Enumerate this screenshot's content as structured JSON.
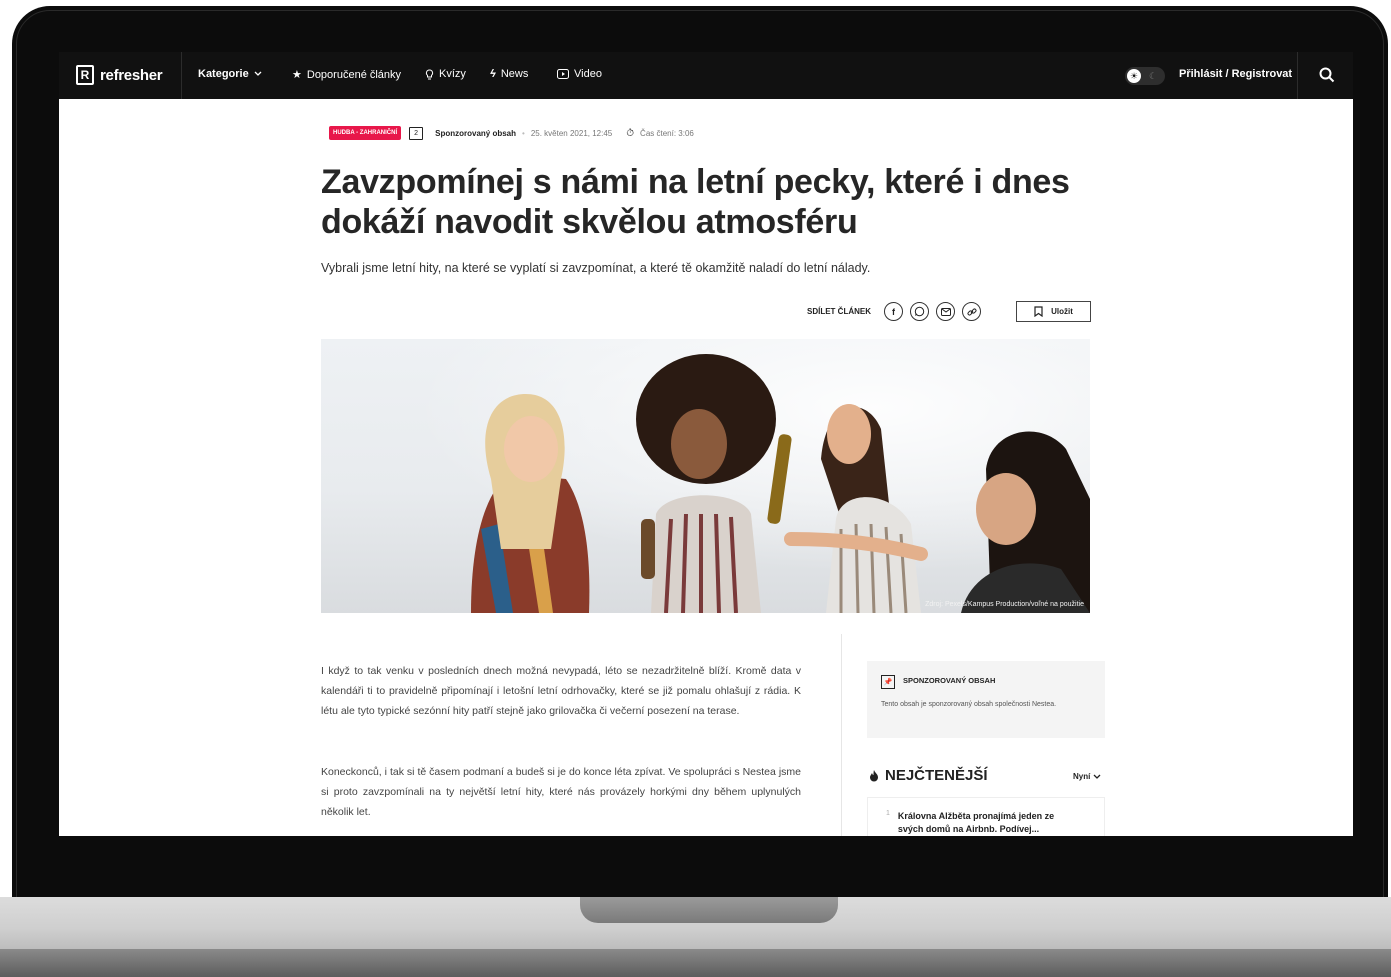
{
  "nav": {
    "logo": "refresher",
    "logo_mark": "R",
    "items": [
      {
        "label": "Kategorie",
        "icon": "chevron-down-icon"
      },
      {
        "label": "Doporučené články",
        "icon": "star-icon"
      },
      {
        "label": "Kvízy",
        "icon": "lightbulb-icon"
      },
      {
        "label": "News",
        "icon": "lightning-icon"
      },
      {
        "label": "Video",
        "icon": "play-icon"
      }
    ],
    "login": "Přihlásit / Registrovat",
    "theme_toggle": {
      "light_icon": "sun-icon",
      "dark_icon": "moon-icon"
    }
  },
  "article": {
    "tag": "HUDBA - ZAHRANIČNÍ",
    "comments": "2",
    "sponsored": "Sponzorovaný obsah",
    "date": "25. květen 2021, 12:45",
    "reading_time": "Čas čtení: 3:06",
    "title": "Zavzpomínej s námi na letní pecky, které i dnes dokáží navodit skvělou atmosféru",
    "lead": "Vybrali jsme letní hity, na které se vyplatí si zavzpomínat, a které tě okamžitě naladí do letní nálady.",
    "share_label": "SDÍLET ČLÁNEK",
    "save_label": "Uložit",
    "image_credit": "Zdroj: Pexels/Kampus Production/voľné na použitie",
    "paragraphs": [
      "I když to tak venku v posledních dnech možná nevypadá, léto se nezadržitelně blíží. Kromě data v kalendáři ti to pravidelně připomínají i letošní letní odrhovačky, které se již pomalu ohlašují z rádia. K létu ale tyto typické sezónní hity patří stejně jako grilovačka či večerní posezení na terase.",
      "Koneckonců, i tak si tě časem podmaní a budeš si je do konce léta zpívat. Ve spolupráci s Nestea jsme si proto zavzpomínali na ty největší letní hity, které nás provázely horkými dny během uplynulých několik let."
    ]
  },
  "sidebar": {
    "sponsor_title": "SPONZOROVANÝ OBSAH",
    "sponsor_text": "Tento obsah je sponzorovaný obsah společnosti Nestea.",
    "popular_title": "NEJČTENĚJŠÍ",
    "popular_filter": "Nyní",
    "popular_items": [
      {
        "num": "1",
        "text": "Královna Alžběta pronajímá jeden ze svých domů na Airbnb. Podívej..."
      }
    ]
  },
  "colors": {
    "accent": "#e8174a",
    "nav_bg": "#111111"
  }
}
